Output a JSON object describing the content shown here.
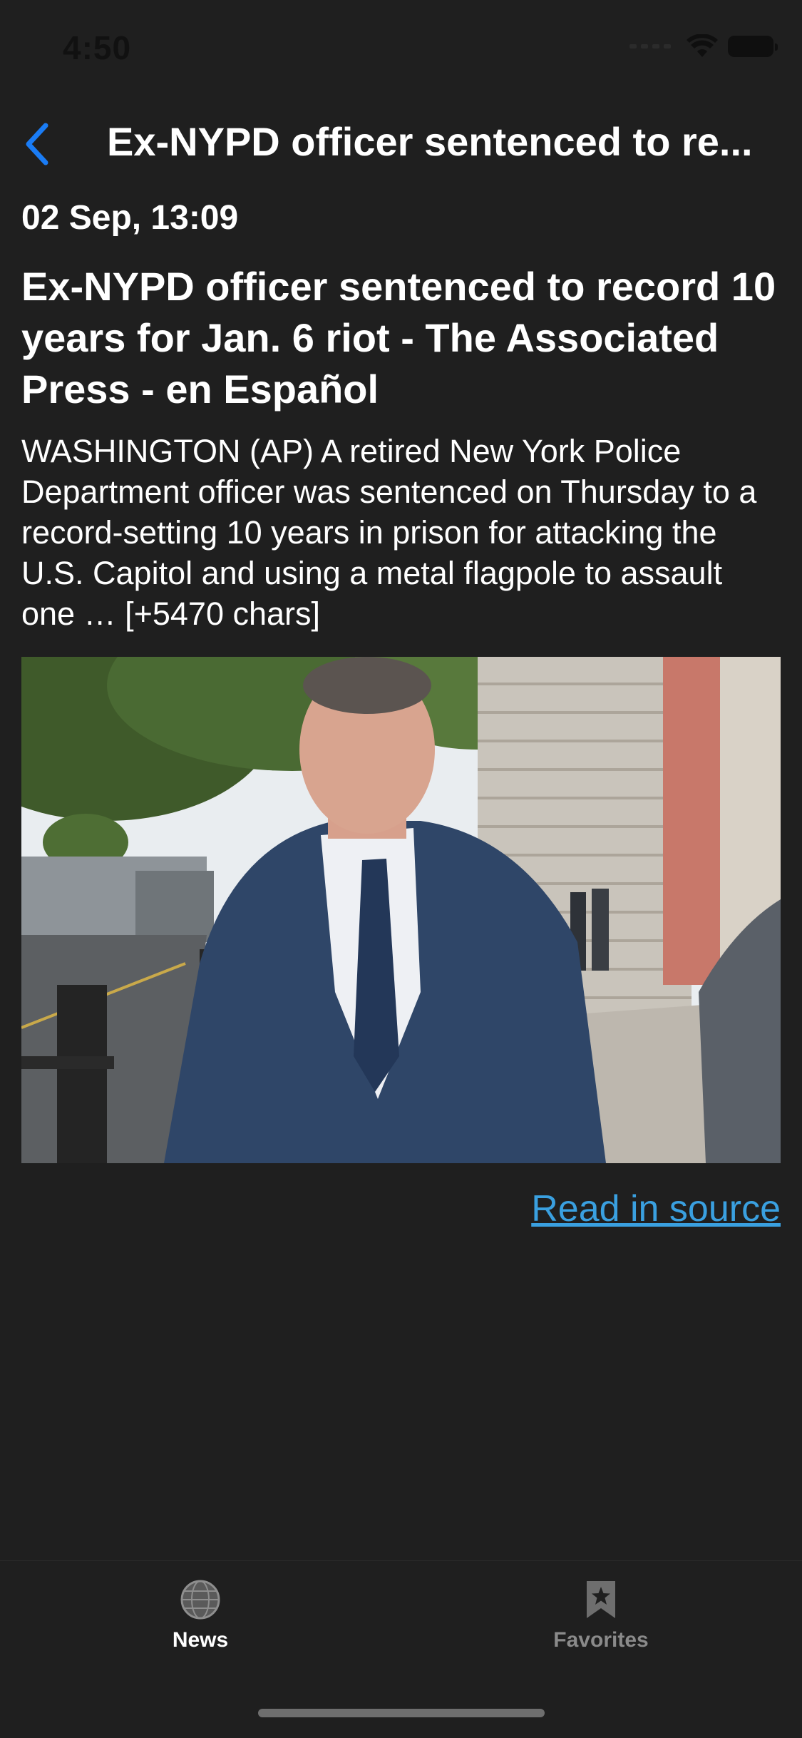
{
  "status_bar": {
    "time": "4:50"
  },
  "nav": {
    "title": "Ex-NYPD officer sentenced to re..."
  },
  "article": {
    "date": "02 Sep, 13:09",
    "headline": "Ex-NYPD officer sentenced to record 10 years for Jan. 6 riot - The Associated Press - en Español",
    "description": "WASHINGTON (AP) A retired New York Police Department officer was sentenced on Thursday to a record-setting 10 years in prison for attacking the U.S. Capitol and using a metal flagpole to assault one … [+5470 chars]",
    "source_link": "Read in source"
  },
  "tabs": [
    {
      "label": "News",
      "icon": "globe-icon",
      "selected": true
    },
    {
      "label": "Favorites",
      "icon": "bookmark-star-icon",
      "selected": false
    }
  ],
  "colors": {
    "background": "#1f1f1f",
    "accent": "#1a7cf5",
    "link": "#3aa0e0",
    "tab_inactive": "#8a8a8a"
  }
}
